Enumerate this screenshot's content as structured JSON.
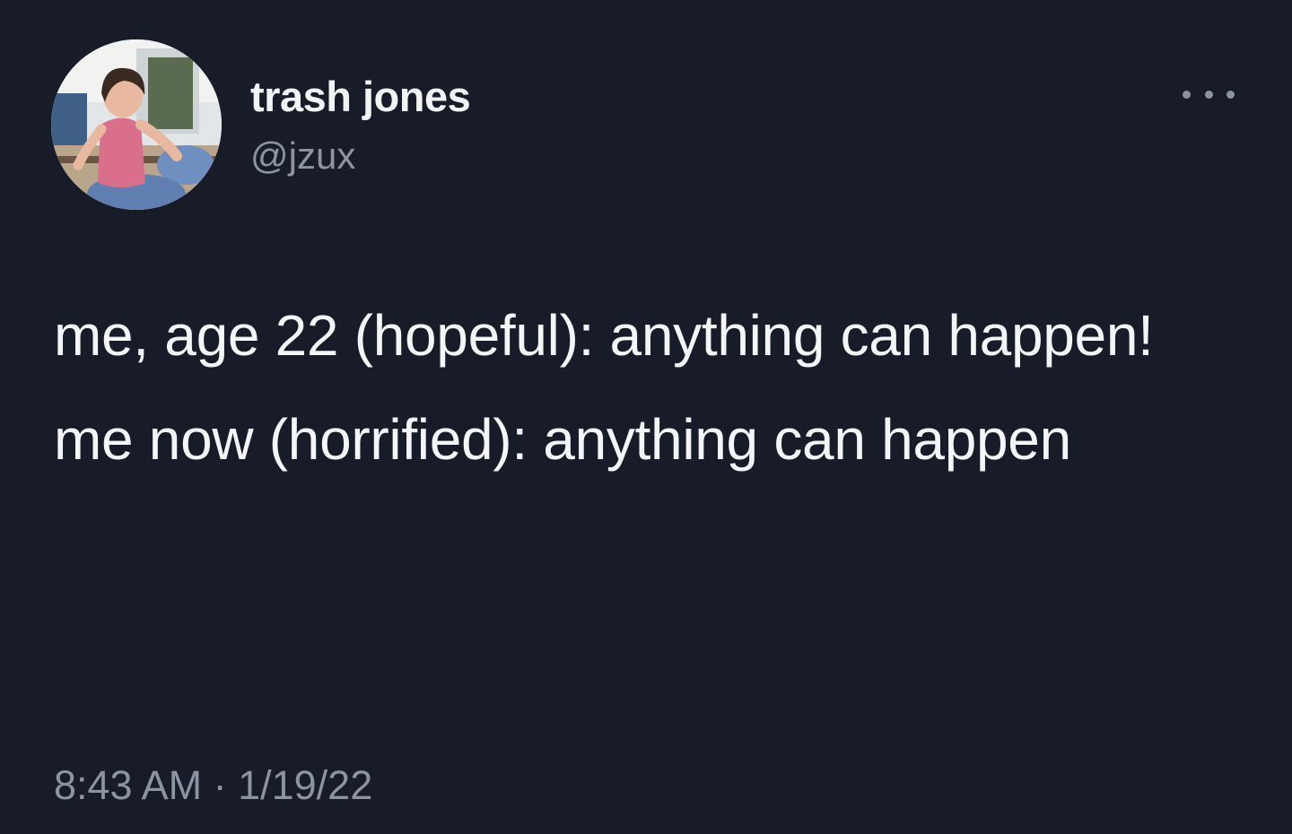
{
  "tweet": {
    "author": {
      "display_name": "trash jones",
      "handle": "@jzux",
      "avatar_icon": "profile-photo"
    },
    "more_icon": "more-horizontal-icon",
    "lines": [
      "me, age 22 (hopeful): anything can happen!",
      "me now (horrified): anything can happen"
    ],
    "timestamp": "8:43 AM · 1/19/22"
  },
  "colors": {
    "background": "#171c28",
    "text_primary": "#f4f5f7",
    "text_secondary": "#8b95a1"
  }
}
